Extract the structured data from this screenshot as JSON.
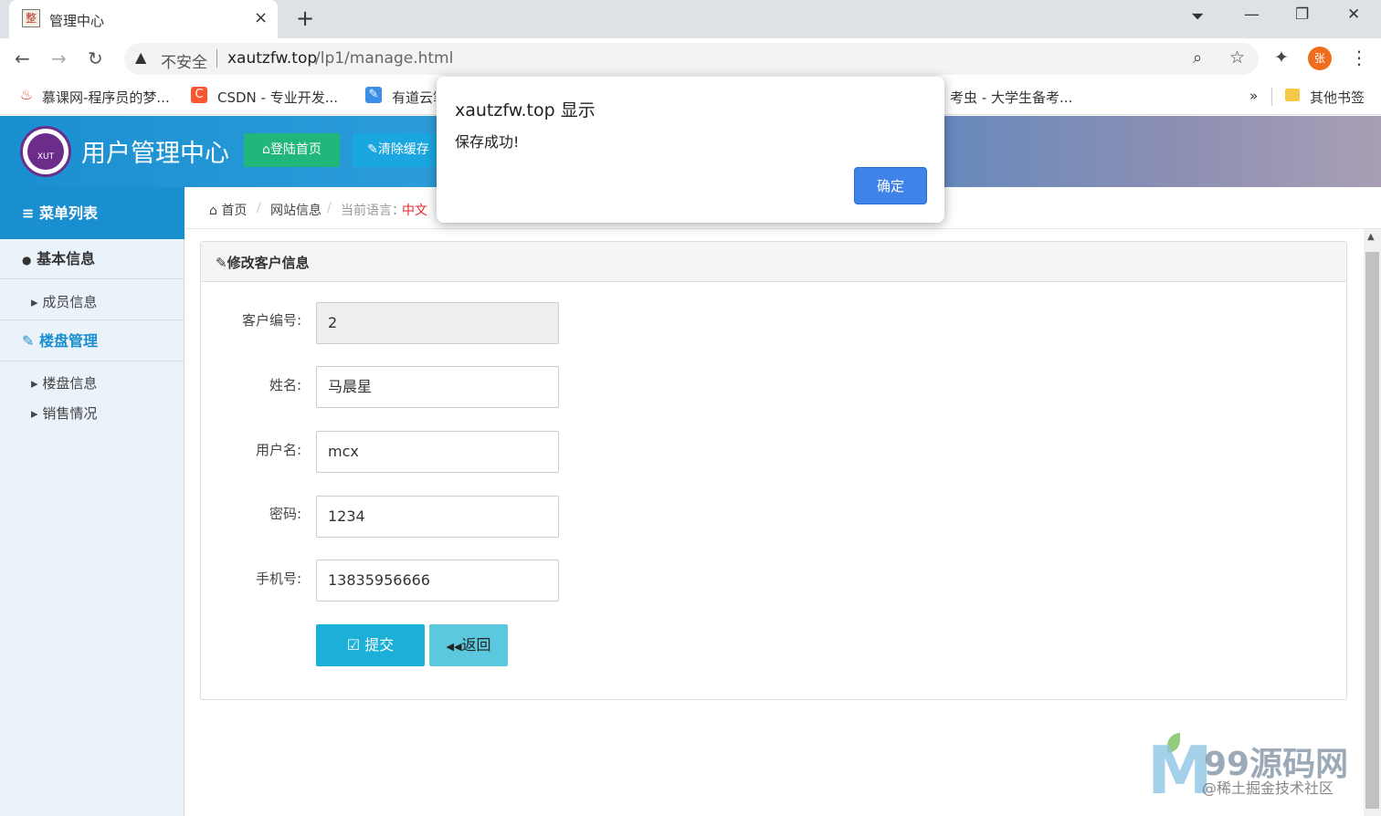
{
  "browser": {
    "tab_title": "管理中心",
    "tab_favicon": "整",
    "new_tab": "+",
    "close_tab": "×",
    "window": {
      "download": "⏷",
      "minimize": "—",
      "restore": "❐",
      "close": "✕"
    },
    "nav": {
      "back": "←",
      "forward": "→",
      "reload": "↻"
    },
    "security_warning_icon": "▲",
    "security_label": "不安全",
    "url_host": "xautzfw.top",
    "url_path": "/lp1/manage.html",
    "profile_initial": "张",
    "icons": {
      "zoom": "⌕",
      "star": "☆",
      "extensions": "✦",
      "menu": "⋮"
    },
    "bookmarks": [
      {
        "label": "慕课网-程序员的梦...",
        "icon": "flame-icon",
        "color": "#e8452c"
      },
      {
        "label": "CSDN - 专业开发...",
        "icon": "csdn-icon",
        "color": "#fc5531"
      },
      {
        "label": "有道云笔记",
        "icon": "youdao-icon",
        "color": "#3a8ee6"
      },
      {
        "label": "考虫 - 大学生备考...",
        "icon": "none",
        "color": "#ffffff"
      }
    ],
    "bookmarks_more": "»",
    "other_bookmarks": "其他书签"
  },
  "app": {
    "logo_text": "XUT",
    "title": "用户管理中心",
    "home_button": "登陆首页",
    "home_icon": "⌂",
    "cache_button": "清除缓存",
    "cache_icon": "✎"
  },
  "sidebar": {
    "menu_header": "菜单列表",
    "menu_icon": "≡",
    "sections": [
      {
        "label": "基本信息",
        "icon": "user-icon",
        "glyph": "●",
        "color": "#333333",
        "items": [
          "成员信息"
        ]
      },
      {
        "label": "楼盘管理",
        "icon": "edit-icon",
        "glyph": "✎",
        "color": "#1a8fd0",
        "items": [
          "楼盘信息",
          "销售情况"
        ]
      }
    ],
    "caret": "▸"
  },
  "breadcrumb": {
    "home_icon": "⌂",
    "home": "首页",
    "site_info": "网站信息",
    "lang_label": "当前语言：",
    "lang_value": "中文",
    "sep": "/"
  },
  "form": {
    "panel_icon": "✎",
    "panel_title": "修改客户信息",
    "fields": [
      {
        "label": "客户编号:",
        "value": "2",
        "readonly": true
      },
      {
        "label": "姓名:",
        "value": "马晨星",
        "readonly": false
      },
      {
        "label": "用户名:",
        "value": "mcx",
        "readonly": false
      },
      {
        "label": "密码:",
        "value": "1234",
        "readonly": false
      },
      {
        "label": "手机号:",
        "value": "13835956666",
        "readonly": false
      }
    ],
    "submit_icon": "☑",
    "submit_label": "提交",
    "back_icon": "◀◀",
    "back_label": "返回"
  },
  "dialog": {
    "title": "xautzfw.top 显示",
    "message": "保存成功!",
    "ok_label": "确定"
  },
  "watermark": {
    "logo": "M",
    "title": "99源码网",
    "sub": "@稀土掘金技术社区"
  },
  "colors": {
    "header_blue": "#1a8fd0",
    "home_green": "#22b77a",
    "cache_blue": "#1aa6e0",
    "submit_cyan": "#1cb0d8",
    "back_cyan": "#5bc8dd",
    "lang_red": "#e8262b",
    "dialog_ok": "#3f82e8"
  }
}
